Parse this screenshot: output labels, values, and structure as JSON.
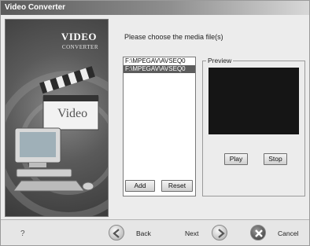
{
  "window": {
    "title": "Video Converter"
  },
  "banner": {
    "brand_line1": "VIDEO",
    "brand_line2": "CONVERTER",
    "clapboard_text": "Video"
  },
  "main": {
    "prompt": "Please choose the media file(s)",
    "files": [
      {
        "path": "F:\\MPEGAV\\AVSEQ0",
        "selected": false
      },
      {
        "path": "F:\\MPEGAV\\AVSEQ0",
        "selected": true
      }
    ],
    "add_label": "Add",
    "reset_label": "Reset"
  },
  "preview": {
    "legend": "Preview",
    "play_label": "Play",
    "stop_label": "Stop"
  },
  "footer": {
    "help_icon": "help-icon",
    "back_label": "Back",
    "next_label": "Next",
    "cancel_label": "Cancel"
  }
}
